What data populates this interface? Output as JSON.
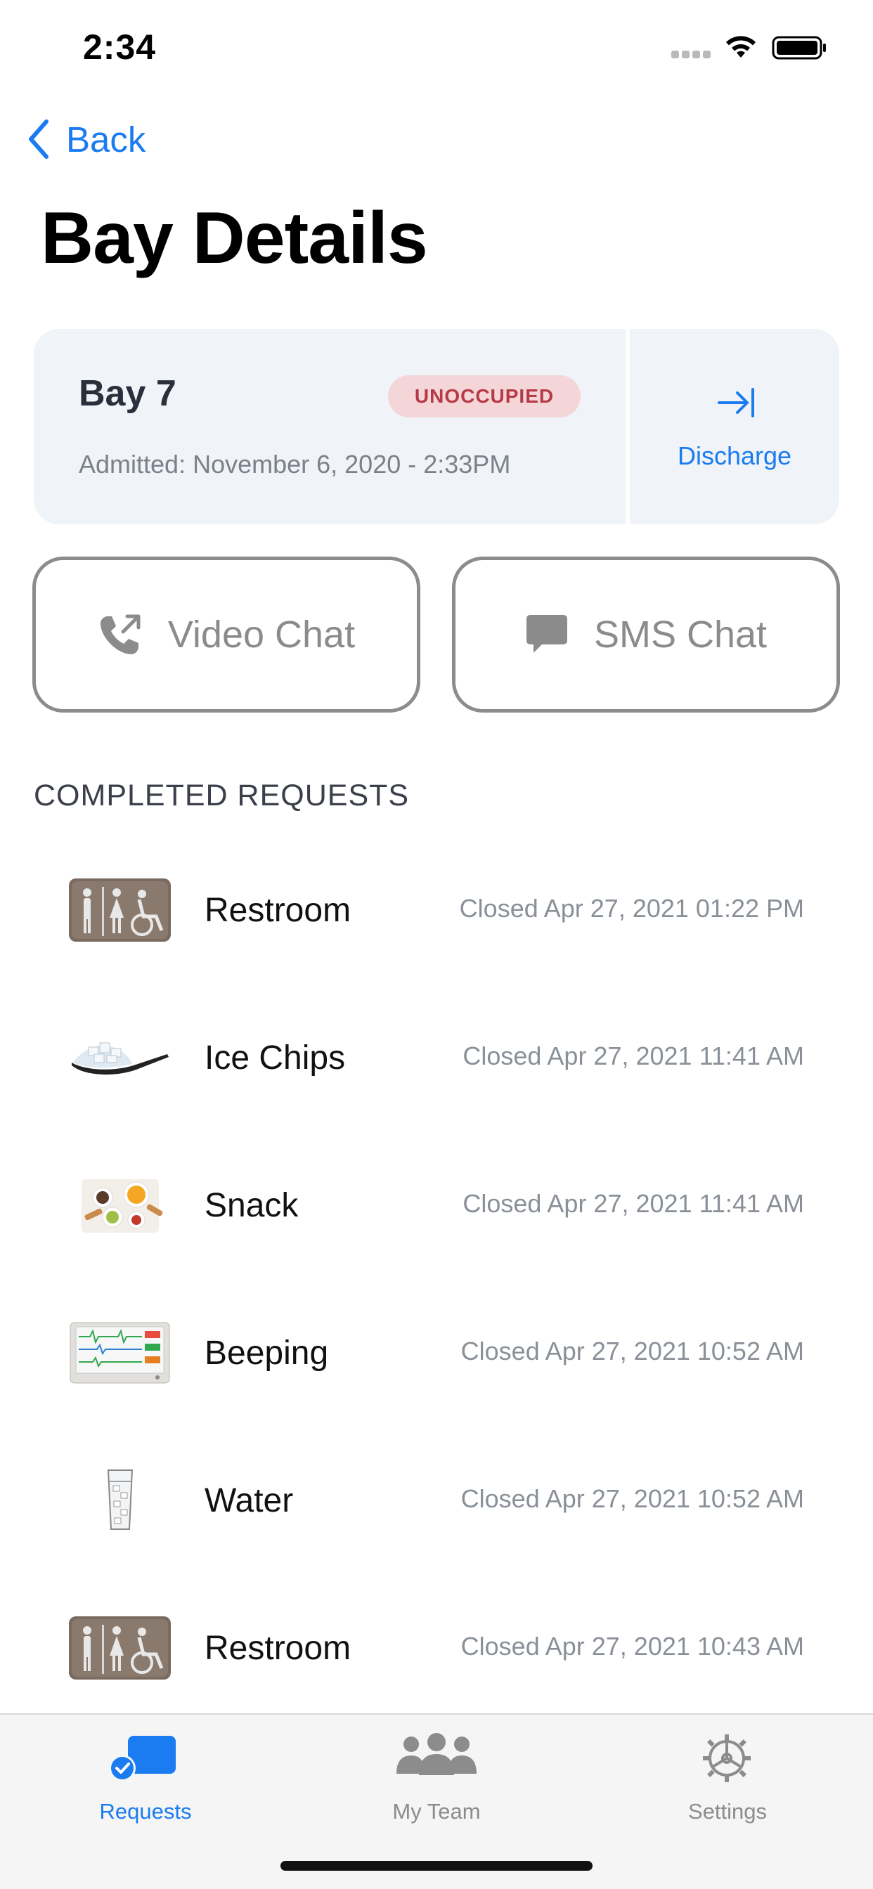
{
  "status_bar": {
    "time": "2:34"
  },
  "nav": {
    "back_label": "Back",
    "title": "Bay Details"
  },
  "bay": {
    "name": "Bay 7",
    "status": "UNOCCUPIED",
    "admitted": "Admitted: November 6, 2020 - 2:33PM",
    "discharge_label": "Discharge"
  },
  "actions": {
    "video_chat": "Video Chat",
    "sms_chat": "SMS Chat"
  },
  "section_header": "COMPLETED REQUESTS",
  "requests": [
    {
      "name": "Restroom",
      "closed": "Closed Apr 27, 2021 01:22 PM",
      "icon": "restroom-icon"
    },
    {
      "name": "Ice Chips",
      "closed": "Closed Apr 27, 2021 11:41 AM",
      "icon": "ice-chips-icon"
    },
    {
      "name": "Snack",
      "closed": "Closed Apr 27, 2021 11:41 AM",
      "icon": "snack-icon"
    },
    {
      "name": "Beeping",
      "closed": "Closed Apr 27, 2021 10:52 AM",
      "icon": "monitor-icon"
    },
    {
      "name": "Water",
      "closed": "Closed Apr 27, 2021 10:52 AM",
      "icon": "water-glass-icon"
    },
    {
      "name": "Restroom",
      "closed": "Closed Apr 27, 2021 10:43 AM",
      "icon": "restroom-icon"
    }
  ],
  "tabs": [
    {
      "label": "Requests",
      "selected": true
    },
    {
      "label": "My Team",
      "selected": false
    },
    {
      "label": "Settings",
      "selected": false
    }
  ],
  "colors": {
    "accent": "#1a7cf0",
    "badge_bg": "#f4d5d8",
    "badge_text": "#b63a46",
    "card_bg": "#f0f3f7"
  }
}
